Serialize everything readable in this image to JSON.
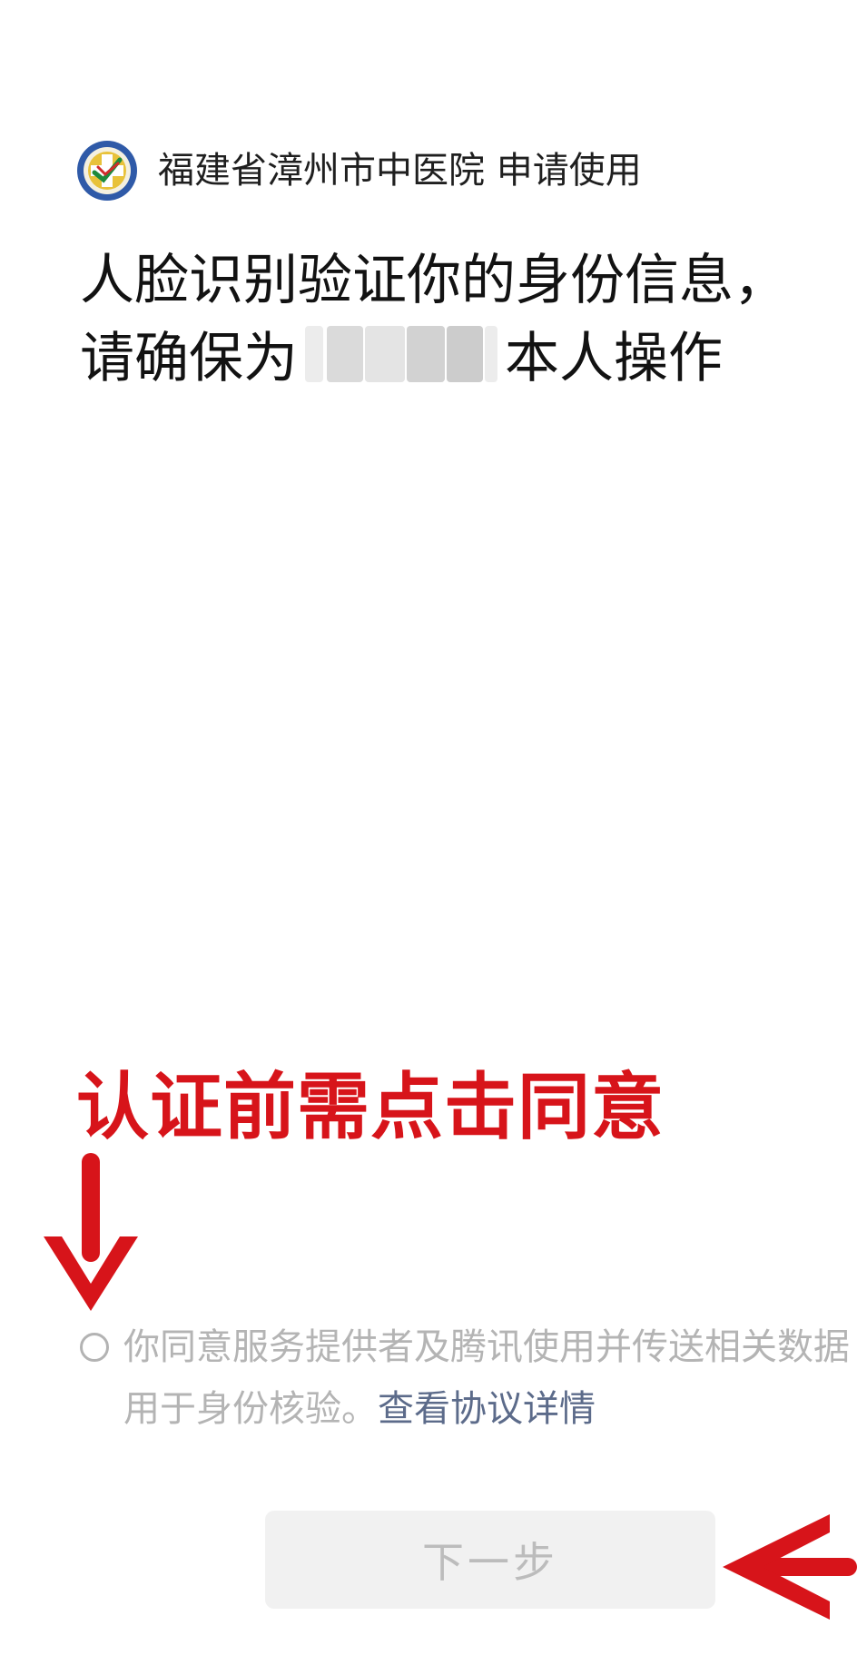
{
  "header": {
    "app_name": "福建省漳州市中医院 申请使用",
    "logo_icon": "hospital-logo-icon"
  },
  "title": {
    "line1": "人脸识别验证你的身份信息，",
    "line2_prefix": "请确保为",
    "line2_suffix": "本人操作"
  },
  "annotation": {
    "text": "认证前需点击同意",
    "color": "#d7141a"
  },
  "agreement": {
    "line1": "你同意服务提供者及腾讯使用并传送相关数据",
    "line2": "用于身份核验。",
    "link": "查看协议详情"
  },
  "next_button": {
    "label": "下一步"
  }
}
